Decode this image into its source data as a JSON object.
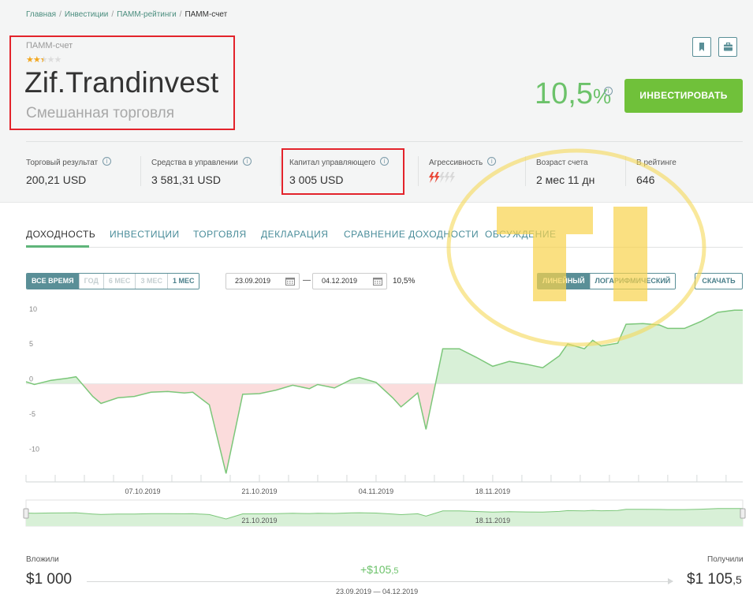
{
  "breadcrumb": [
    {
      "label": "Главная"
    },
    {
      "label": "Инвестиции"
    },
    {
      "label": "ПАММ-рейтинги"
    },
    {
      "label": "ПАММ-счет"
    }
  ],
  "account": {
    "type_label": "ПАММ-счет",
    "rating": 2.5,
    "rating_max": 5,
    "name": "Zif.Trandinvest",
    "subtitle": "Смешанная торговля",
    "return_int": "10,5",
    "return_unit": "%"
  },
  "actions": {
    "invest_label": "ИНВЕСТИРОВАТЬ",
    "bookmark_icon": "bookmark-icon",
    "portfolio_icon": "briefcase-icon"
  },
  "stats": [
    {
      "label": "Торговый результат",
      "value": "200,21 USD"
    },
    {
      "label": "Средства в управлении",
      "value": "3 581,31 USD"
    },
    {
      "label": "Капитал управляющего",
      "value": "3 005 USD"
    },
    {
      "label": "Агрессивность",
      "aggression_level": 2,
      "aggression_max": 5
    },
    {
      "label": "Возраст счета",
      "value": "2 мес 11 дн"
    },
    {
      "label": "В рейтинге",
      "value": "646"
    }
  ],
  "tabs": [
    {
      "label": "ДОХОДНОСТЬ",
      "active": true
    },
    {
      "label": "ИНВЕСТИЦИИ"
    },
    {
      "label": "ТОРГОВЛЯ"
    },
    {
      "label": "ДЕКЛАРАЦИЯ"
    },
    {
      "label": "СРАВНЕНИЕ ДОХОДНОСТИ"
    },
    {
      "label": "ОБСУЖДЕНИЕ"
    }
  ],
  "controls": {
    "periods": [
      {
        "label": "ВСЕ ВРЕМЯ",
        "state": "selected"
      },
      {
        "label": "ГОД",
        "state": "disabled"
      },
      {
        "label": "6 МЕС",
        "state": "disabled"
      },
      {
        "label": "3 МЕС",
        "state": "disabled"
      },
      {
        "label": "1 МЕС",
        "state": "enabled"
      }
    ],
    "date_from": "23.09.2019",
    "date_sep": "—",
    "date_to": "04.12.2019",
    "period_return": "10,5%",
    "scales": [
      {
        "label": "ЛИНЕЙНЫЙ",
        "state": "selected"
      },
      {
        "label": "ЛОГАРИФМИЧЕСКИЙ",
        "state": "enabled"
      }
    ],
    "download_label": "СКАЧАТЬ"
  },
  "chart_data": {
    "type": "area",
    "ylim": [
      -14,
      12
    ],
    "yticks": [
      10,
      5,
      0,
      -5,
      -10
    ],
    "xlim": [
      "2019-09-23",
      "2019-12-04"
    ],
    "xticks": [
      "07.10.2019",
      "21.10.2019",
      "04.11.2019",
      "18.11.2019"
    ],
    "navigator_xticks": [
      "21.10.2019",
      "18.11.2019"
    ],
    "positive_color": "#d8f0d7",
    "negative_color": "#fbdcdc",
    "line_color": "#7cc77a",
    "series": [
      {
        "values": [
          [
            "2019-09-23",
            0.3
          ],
          [
            "2019-09-24",
            -0.1
          ],
          [
            "2019-09-26",
            0.5
          ],
          [
            "2019-09-28",
            0.8
          ],
          [
            "2019-09-29",
            1.0
          ],
          [
            "2019-10-01",
            -1.8
          ],
          [
            "2019-10-02",
            -2.8
          ],
          [
            "2019-10-04",
            -2.0
          ],
          [
            "2019-10-06",
            -1.8
          ],
          [
            "2019-10-08",
            -1.2
          ],
          [
            "2019-10-10",
            -1.1
          ],
          [
            "2019-10-12",
            -1.3
          ],
          [
            "2019-10-13",
            -1.2
          ],
          [
            "2019-10-15",
            -3.0
          ],
          [
            "2019-10-17",
            -12.8
          ],
          [
            "2019-10-19",
            -1.5
          ],
          [
            "2019-10-21",
            -1.4
          ],
          [
            "2019-10-23",
            -0.9
          ],
          [
            "2019-10-25",
            -0.2
          ],
          [
            "2019-10-27",
            -0.7
          ],
          [
            "2019-10-28",
            -0.1
          ],
          [
            "2019-10-30",
            -0.6
          ],
          [
            "2019-11-01",
            0.6
          ],
          [
            "2019-11-02",
            0.9
          ],
          [
            "2019-11-04",
            0.2
          ],
          [
            "2019-11-06",
            -2.0
          ],
          [
            "2019-11-07",
            -3.3
          ],
          [
            "2019-11-09",
            -1.3
          ],
          [
            "2019-11-10",
            -6.5
          ],
          [
            "2019-11-12",
            5.0
          ],
          [
            "2019-11-14",
            5.0
          ],
          [
            "2019-11-16",
            3.8
          ],
          [
            "2019-11-18",
            2.5
          ],
          [
            "2019-11-20",
            3.2
          ],
          [
            "2019-11-22",
            2.8
          ],
          [
            "2019-11-24",
            2.3
          ],
          [
            "2019-11-26",
            4.0
          ],
          [
            "2019-11-27",
            5.7
          ],
          [
            "2019-11-29",
            5.0
          ],
          [
            "2019-11-30",
            6.2
          ],
          [
            "2019-12-01",
            5.4
          ],
          [
            "2019-12-03",
            5.8
          ],
          [
            "2019-12-04",
            8.5
          ]
        ]
      }
    ],
    "series_tail": [
      [
        "2019-12-06",
        8.6
      ],
      [
        "2019-12-08",
        8.4
      ],
      [
        "2019-12-09",
        7.9
      ],
      [
        "2019-12-11",
        7.9
      ],
      [
        "2019-12-13",
        8.9
      ],
      [
        "2019-12-15",
        10.2
      ],
      [
        "2019-12-17",
        10.5
      ],
      [
        "2019-12-18",
        10.5
      ]
    ]
  },
  "footer": {
    "invested_label": "Вложили",
    "invested_value": "$1 000",
    "received_label": "Получили",
    "received_int": "$1 105",
    "received_frac": ",5",
    "profit_int": "+$105",
    "profit_frac": ",5",
    "range": "23.09.2019 — 04.12.2019"
  }
}
